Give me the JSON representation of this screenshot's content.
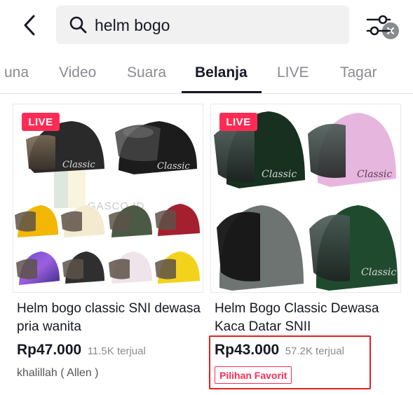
{
  "search": {
    "query": "helm bogo",
    "icon": "search-icon"
  },
  "header": {
    "back_icon": "chevron-left-icon",
    "clear_icon": "clear-icon",
    "filter_icon": "filter-sliders-icon"
  },
  "tabs": [
    {
      "label": "una",
      "active": false
    },
    {
      "label": "Video",
      "active": false
    },
    {
      "label": "Suara",
      "active": false
    },
    {
      "label": "Belanja",
      "active": true
    },
    {
      "label": "LIVE",
      "active": false
    },
    {
      "label": "Tagar",
      "active": false
    }
  ],
  "products": [
    {
      "live_badge": "LIVE",
      "title": "Helm bogo classic SNI dewasa pria wanita",
      "price": "Rp47.000",
      "sold": "11.5K terjual",
      "shop": "khalillah ( Allen )",
      "watermark": "GASCO.ID",
      "helmet_text": "Classic"
    },
    {
      "live_badge": "LIVE",
      "title": "Helm Bogo Classic Dewasa Kaca Datar SNII",
      "price": "Rp43.000",
      "sold": "57.2K terjual",
      "badge": "Pilihan Favorit",
      "helmet_text": "Classic"
    }
  ],
  "colors": {
    "accent": "#fe2c55",
    "highlight": "#e02020",
    "text": "#161823",
    "muted": "#8a8b91"
  }
}
